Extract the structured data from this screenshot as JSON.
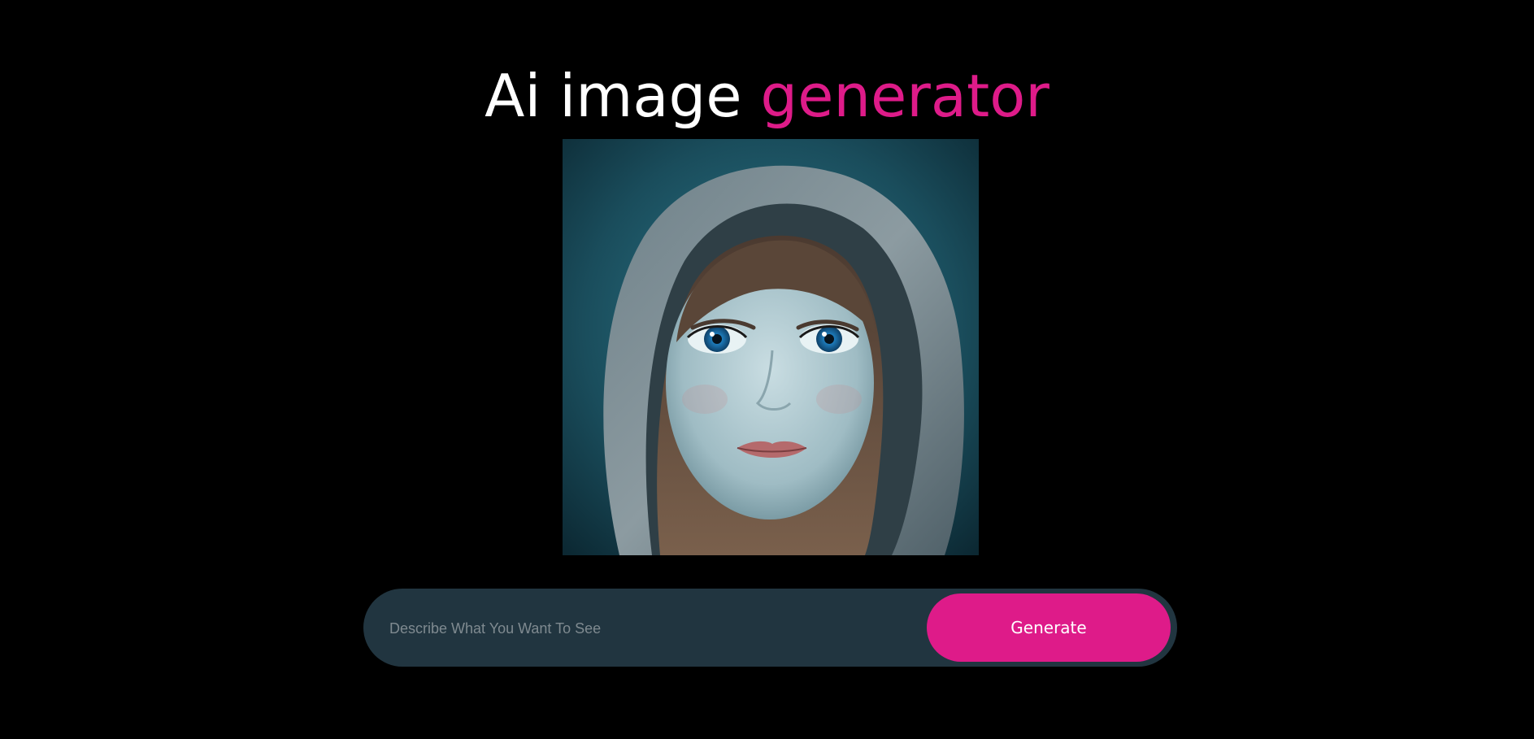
{
  "header": {
    "title_plain": "Ai image",
    "title_accent": "generator"
  },
  "preview": {
    "alt": "Generated image"
  },
  "prompt": {
    "placeholder": "Describe What You Want To See",
    "value": "",
    "button_label": "Generate"
  },
  "colors": {
    "background": "#000000",
    "accent": "#de1b89",
    "bar": "#213540",
    "title": "#ffffff"
  }
}
